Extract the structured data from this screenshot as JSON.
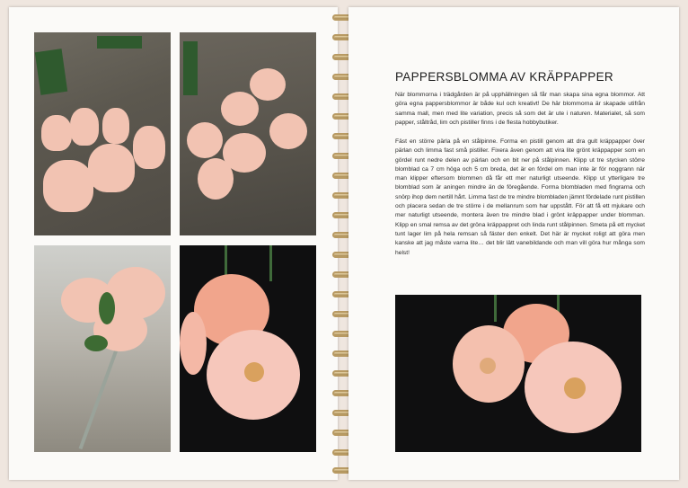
{
  "page": {
    "title": "PAPPERSBLOMMA AV KRÄPPAPPER",
    "paragraph_1": "När blommorna i trädgården är på upphällningen så får man skapa sina egna blommor. Att göra egna pappersblommor är både kul och kreativt! De här blommorna är skapade utifrån samma mall, men med lite variation, precis så som det är ute i naturen. Materialet, så som papper, ståltråd, lim och pistiller finns i de flesta hobbybutiker.",
    "paragraph_2": "Fäst en större pärla på en stålpinne. Forma en pistill genom att dra gult kräppapper över pärlan och limma fast små pistiller. Fixera även genom att vira lite grönt kräppapper som en gördel runt nedre delen av pärlan och en bit ner på stålpinnen. Klipp ut tre stycken större blomblad ca 7 cm höga och 5 cm breda, det är en fördel om man inte är för noggrann när man klipper eftersom blommen då får ett mer naturligt utseende. Klipp ut ytterligare tre blomblad som är aningen mindre än de föregående. Forma blombladen med fingrarna och snörp ihop dem nertill hårt. Limma fast de tre mindre blombladen jämnt fördelade runt pistillen och placera sedan de tre större i de mellanrum som har uppstått. För att få ett mjukare och mer naturligt utseende, montera även tre mindre blad i grönt kräppapper under blomman. Klipp en smal remsa av det gröna kräppappret och linda runt stålpinnen. Smeta på ett mycket tunt lager lim på hela remsan så fäster den enkelt. Det här är mycket roligt att göra men kanske att jag måste varna lite… det blir lätt vanebildande och man vill göra hur många som helst!"
  },
  "photos": [
    {
      "subject": "cut crepe paper petals on wooden table"
    },
    {
      "subject": "shaped paper petals on wooden table"
    },
    {
      "subject": "single paper flower on stem"
    },
    {
      "subject": "peach paper flowers on dark background"
    },
    {
      "subject": "pink and peach paper flowers on dark background"
    }
  ],
  "colors": {
    "page": "#fbfaf8",
    "petal": "#f2c3b2",
    "stem": "#3f6a3a",
    "spiral": "#b89a63"
  }
}
